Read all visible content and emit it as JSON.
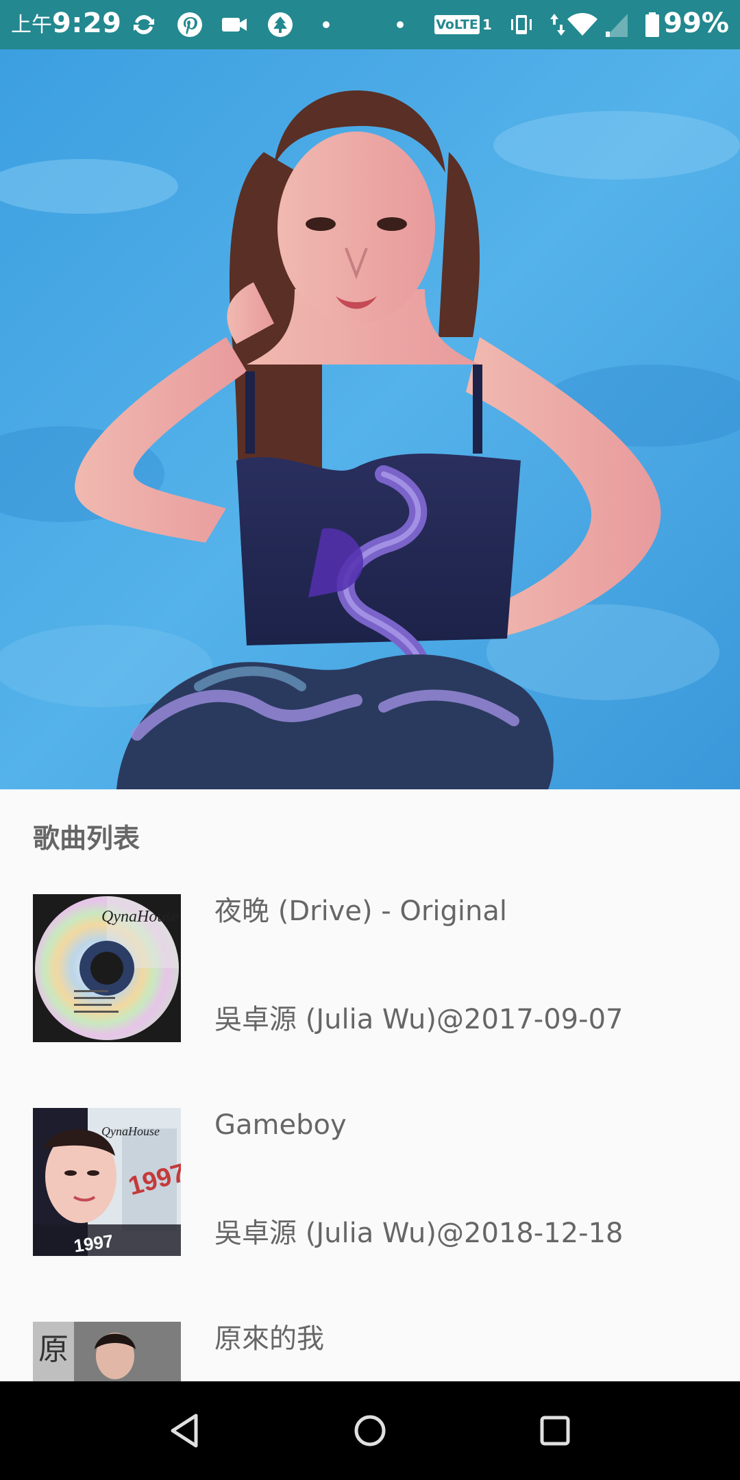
{
  "status_bar": {
    "time_prefix": "上午",
    "time": "9:29",
    "volte": "VoLTE",
    "sim": "1",
    "battery": "99%"
  },
  "hero": {
    "image": "artist-photo"
  },
  "song_list": {
    "title": "歌曲列表",
    "items": [
      {
        "title": "夜晚 (Drive) - Original",
        "meta": "吳卓源 (Julia Wu)@2017-09-07",
        "thumb": "cd-disc-cover"
      },
      {
        "title": "Gameboy",
        "meta": "吳卓源 (Julia Wu)@2018-12-18",
        "thumb": "magazine-cover"
      },
      {
        "title": "原來的我",
        "meta": "",
        "thumb": "portrait-cover"
      }
    ]
  },
  "nav_bar": {
    "back": "back-icon",
    "home": "home-icon",
    "recents": "recents-icon"
  },
  "colors": {
    "status_bar": "#23888f",
    "hero_bg": "#4aa9e3",
    "text": "#666666",
    "nav_bar": "#000000"
  }
}
